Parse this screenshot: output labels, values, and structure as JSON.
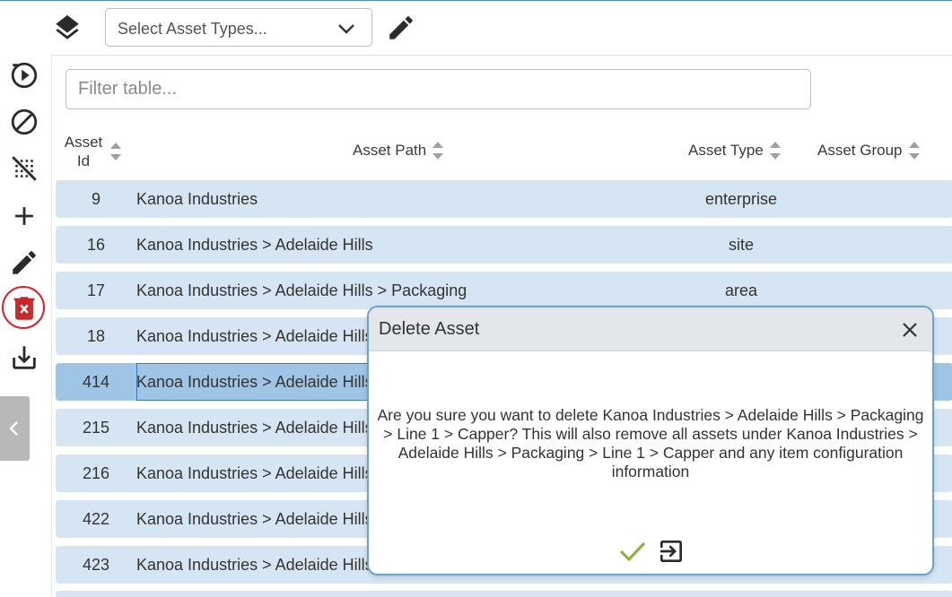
{
  "toolbar": {
    "asset_type_placeholder": "Select Asset Types..."
  },
  "sidebar": {
    "items": [
      {
        "icon": "play-circle-icon"
      },
      {
        "icon": "block-icon"
      },
      {
        "icon": "grain-off-icon"
      },
      {
        "icon": "add-icon"
      },
      {
        "icon": "edit-icon"
      },
      {
        "icon": "delete-icon",
        "highlight_color": "#d8232a"
      },
      {
        "icon": "download-icon"
      }
    ],
    "collapse_icon": "chevron-left-icon"
  },
  "filter": {
    "placeholder": "Filter table..."
  },
  "table": {
    "headers": {
      "id": "Asset Id",
      "path": "Asset Path",
      "type": "Asset Type",
      "group": "Asset Group"
    },
    "rows": [
      {
        "id": "9",
        "path": "Kanoa Industries",
        "type": "enterprise",
        "group": ""
      },
      {
        "id": "16",
        "path": "Kanoa Industries > Adelaide Hills",
        "type": "site",
        "group": ""
      },
      {
        "id": "17",
        "path": "Kanoa Industries > Adelaide Hills > Packaging",
        "type": "area",
        "group": ""
      },
      {
        "id": "18",
        "path": "Kanoa Industries > Adelaide Hills",
        "type": "",
        "group": ""
      },
      {
        "id": "414",
        "path": "Kanoa Industries > Adelaide Hills",
        "type": "",
        "group": "",
        "selected": true
      },
      {
        "id": "215",
        "path": "Kanoa Industries > Adelaide Hills",
        "type": "",
        "group": ""
      },
      {
        "id": "216",
        "path": "Kanoa Industries > Adelaide Hills",
        "type": "",
        "group": ""
      },
      {
        "id": "422",
        "path": "Kanoa Industries > Adelaide Hills",
        "type": "",
        "group": ""
      },
      {
        "id": "423",
        "path": "Kanoa Industries > Adelaide Hills",
        "type": "",
        "group": ""
      }
    ]
  },
  "dialog": {
    "title": "Delete Asset",
    "message": "Are you sure you want to delete Kanoa Industries > Adelaide Hills > Packaging > Line 1 > Capper? This will also remove all assets under Kanoa Industries > Adelaide Hills > Packaging > Line 1 > Capper and any item configuration information",
    "confirm_icon": "check-icon",
    "cancel_icon": "exit-icon",
    "confirm_color": "#8ab43a"
  },
  "colors": {
    "row_bg": "#d5e5f4",
    "row_selected_bg": "#9fc5e6",
    "dialog_border": "#6aa3cc"
  }
}
